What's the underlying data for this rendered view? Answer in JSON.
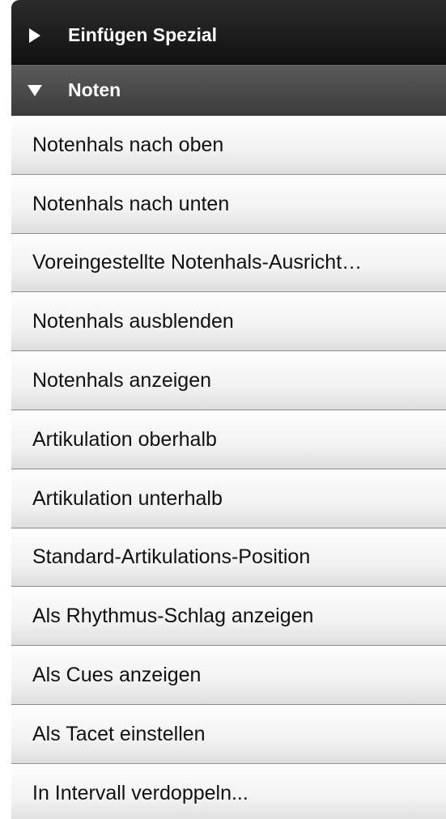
{
  "sections": {
    "insert_special": {
      "label": "Einfügen Spezial",
      "expanded": false
    },
    "notes": {
      "label": "Noten",
      "expanded": true
    }
  },
  "items": [
    "Notenhals nach oben",
    "Notenhals nach unten",
    "Voreingestellte Notenhals-Ausricht…",
    "Notenhals ausblenden",
    "Notenhals anzeigen",
    "Artikulation oberhalb",
    "Artikulation unterhalb",
    "Standard-Artikulations-Position",
    "Als Rhythmus-Schlag anzeigen",
    "Als Cues anzeigen",
    "Als Tacet einstellen",
    "In Intervall verdoppeln..."
  ]
}
